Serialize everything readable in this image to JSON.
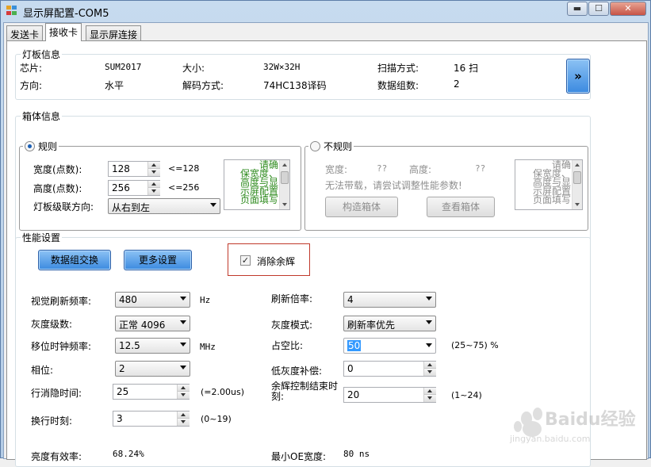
{
  "window": {
    "title": "显示屏配置-COM5",
    "controls": {
      "minimize": "▬",
      "maximize": "☐",
      "close": "✕"
    }
  },
  "tabs": [
    {
      "label": "发送卡"
    },
    {
      "label": "接收卡"
    },
    {
      "label": "显示屏连接"
    }
  ],
  "board_info": {
    "title": "灯板信息",
    "chip_label": "芯片:",
    "chip_value": "SUM2017",
    "size_label": "大小:",
    "size_value": "32W×32H",
    "scan_label": "扫描方式:",
    "scan_value": "16 扫",
    "direction_label": "方向:",
    "direction_value": "水平",
    "decode_label": "解码方式:",
    "decode_value": "74HC138译码",
    "groups_label": "数据组数:",
    "groups_value": "2",
    "more_button": "»"
  },
  "cabinet_info": {
    "title": "箱体信息",
    "regular": {
      "label": "规则",
      "width_label": "宽度(点数):",
      "width_value": "128",
      "width_hint": "<=128",
      "height_label": "高度(点数):",
      "height_value": "256",
      "height_hint": "<=256",
      "cascade_label": "灯板级联方向:",
      "cascade_value": "从右到左",
      "note_lines": [
        "请确",
        "保宽度、",
        "高度与显",
        "示屏配置",
        "页面填写"
      ]
    },
    "irregular": {
      "label": "不规则",
      "width_label": "宽度:",
      "width_value": "??",
      "height_label": "高度:",
      "height_value": "??",
      "warning": "无法带载，请尝试调整性能参数!",
      "build_button": "构造箱体",
      "view_button": "查看箱体",
      "note_lines": [
        "请确",
        "保宽度、",
        "高度与显",
        "示屏配置",
        "页面填写"
      ]
    }
  },
  "performance": {
    "title": "性能设置",
    "swap_button": "数据组交换",
    "more_button": "更多设置",
    "ghost_label": "消除余辉",
    "ghost_checked": "✓",
    "refresh_label": "视觉刷新频率:",
    "refresh_value": "480",
    "refresh_unit": "Hz",
    "multiplier_label": "刷新倍率:",
    "multiplier_value": "4",
    "gray_label": "灰度级数:",
    "gray_value": "正常 4096",
    "gray_mode_label": "灰度模式:",
    "gray_mode_value": "刷新率优先",
    "shift_label": "移位时钟频率:",
    "shift_value": "12.5",
    "shift_unit": "MHz",
    "duty_label": "占空比:",
    "duty_value": "50",
    "duty_hint": "(25~75) %",
    "phase_label": "相位:",
    "phase_value": "2",
    "lowgray_label": "低灰度补偿:",
    "lowgray_value": "0",
    "blank_label": "行消隐时间:",
    "blank_value": "25",
    "blank_hint": "(=2.00us)",
    "afterglow_label_1": "余辉控制结束时",
    "afterglow_label_2": "刻:",
    "afterglow_value": "20",
    "afterglow_hint": "(1~24)",
    "switch_label": "换行时刻:",
    "switch_value": "3",
    "switch_hint": "(0~19)",
    "efficiency_label": "亮度有效率:",
    "efficiency_value": "68.24%",
    "min_oe_label": "最小OE宽度:",
    "min_oe_value": "80 ns"
  },
  "watermark": {
    "brand": "Baidu经验",
    "url": "jingyan.baidu.com"
  },
  "colors": {
    "accent_blue": "#3b8ae0",
    "note_green": "#2e8b1e",
    "highlight_red": "#c0392b"
  }
}
